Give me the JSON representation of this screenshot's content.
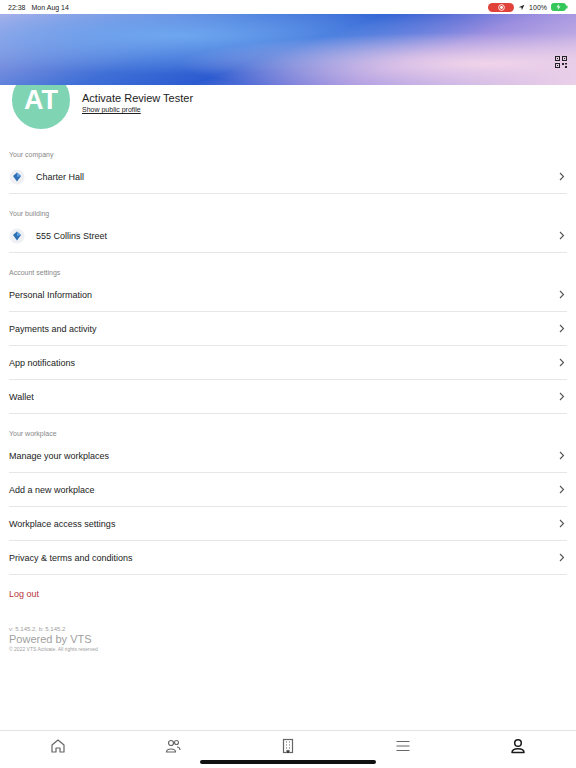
{
  "status_bar": {
    "time": "22:38",
    "date": "Mon Aug 14",
    "battery": "100%",
    "recording": true,
    "charging": true
  },
  "profile": {
    "initials": "AT",
    "name": "Activate Review Tester",
    "link": "Show public profile"
  },
  "sections": [
    {
      "label": "Your company",
      "items": [
        {
          "label": "Charter Hall",
          "kind": "logo"
        }
      ]
    },
    {
      "label": "Your building",
      "items": [
        {
          "label": "555 Collins Street",
          "kind": "logo"
        }
      ]
    },
    {
      "label": "Account settings",
      "items": [
        {
          "label": "Personal Information",
          "kind": "plain"
        },
        {
          "label": "Payments and activity",
          "kind": "plain"
        },
        {
          "label": "App notifications",
          "kind": "plain"
        },
        {
          "label": "Wallet",
          "kind": "plain"
        }
      ]
    },
    {
      "label": "Your workplace",
      "items": [
        {
          "label": "Manage your workplaces",
          "kind": "plain"
        },
        {
          "label": "Add a new workplace",
          "kind": "plain"
        },
        {
          "label": "Workplace access settings",
          "kind": "plain"
        },
        {
          "label": "Privacy & terms and conditions",
          "kind": "plain"
        }
      ]
    }
  ],
  "log_out": "Log out",
  "footer": {
    "version": "v: 5.145.2, b: 5.145.2",
    "powered": "Powered by VTS",
    "copyright": "© 2022 VTS Activate. All rights reserved"
  },
  "tab_bar": [
    {
      "kind": "home",
      "selected": false
    },
    {
      "kind": "people",
      "selected": false
    },
    {
      "kind": "building",
      "selected": false
    },
    {
      "kind": "menu",
      "selected": false
    },
    {
      "kind": "profile",
      "selected": true
    }
  ]
}
